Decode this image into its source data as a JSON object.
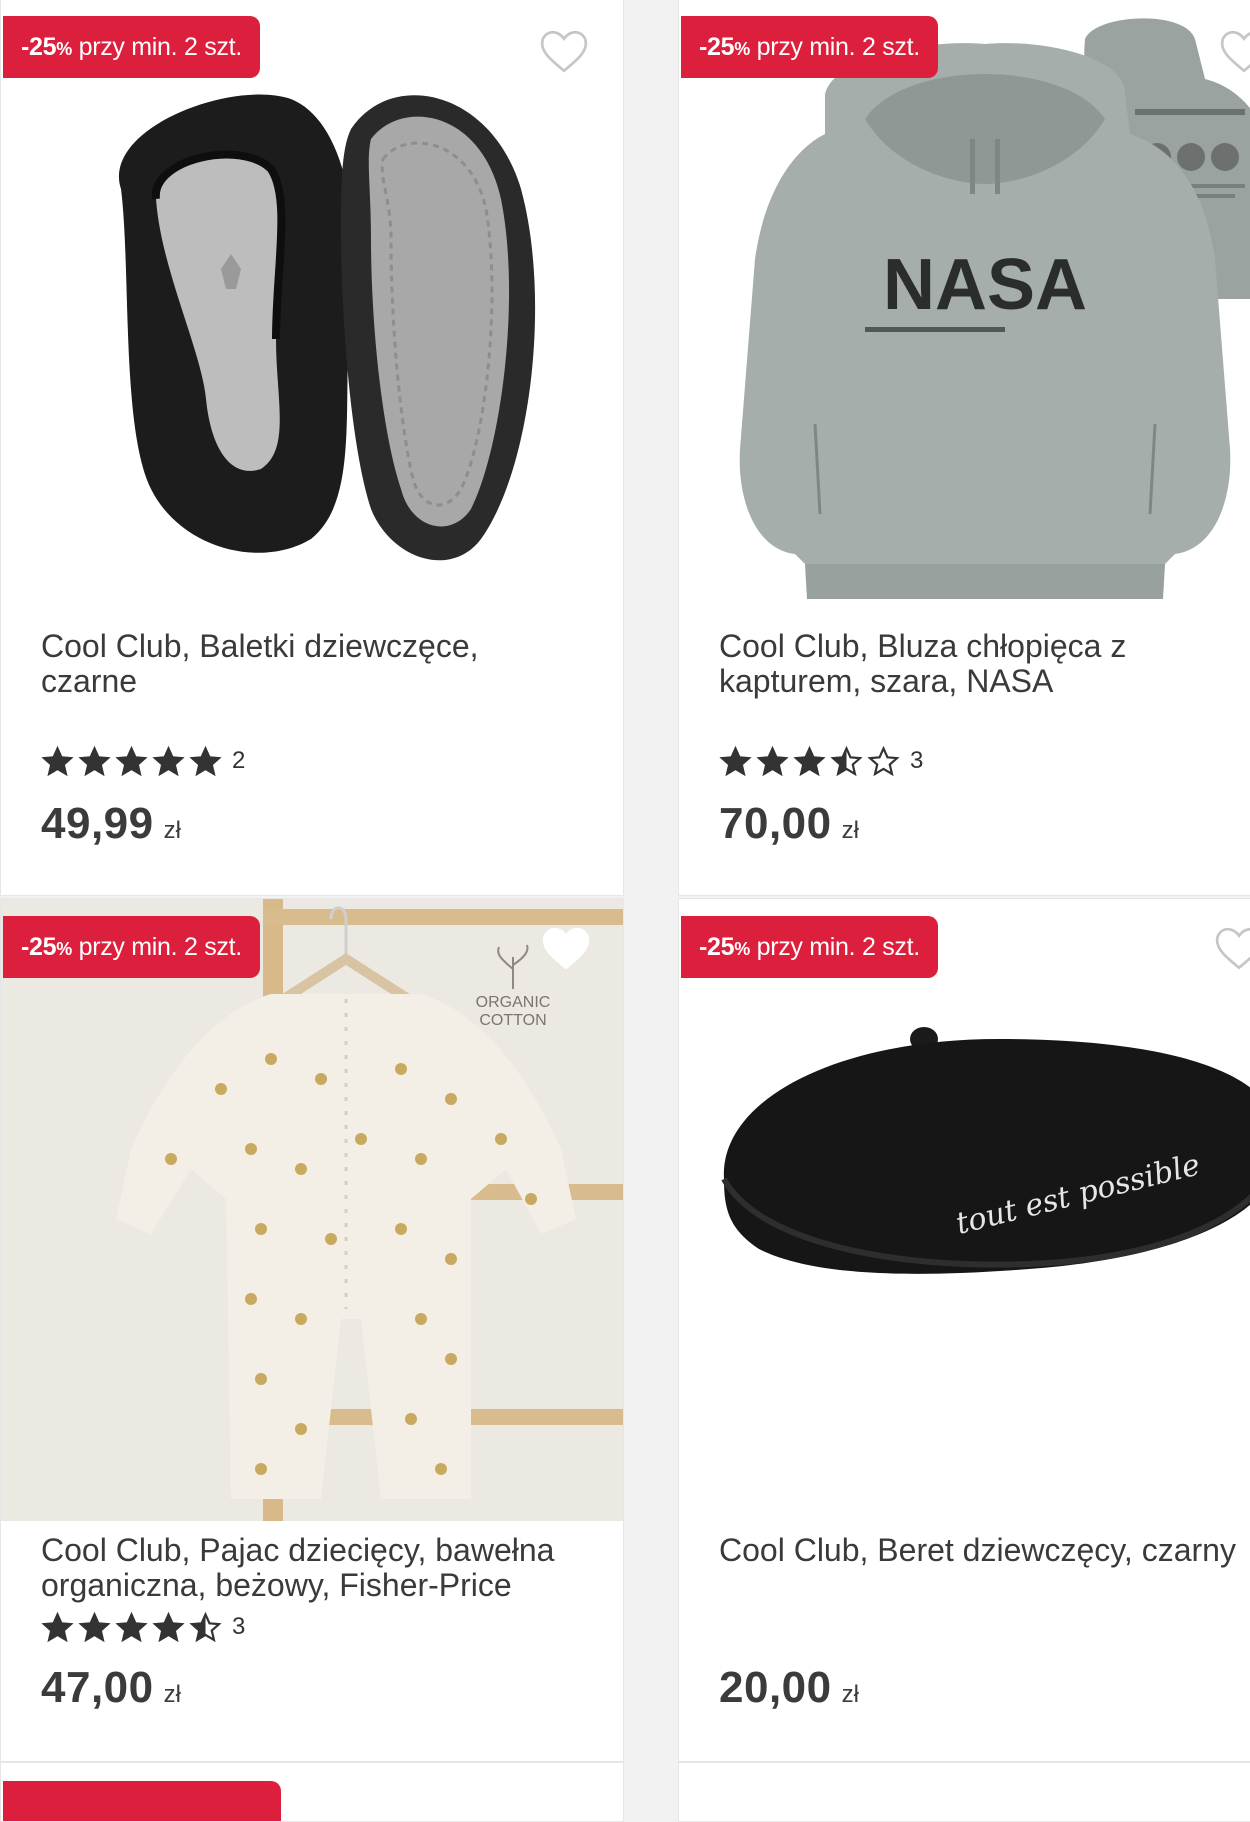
{
  "products": [
    {
      "badge": {
        "prefix": "-25",
        "pct": "%",
        "text": " przy min. 2 szt."
      },
      "title": "Cool Club, Baletki dziewczęce,\nczarne",
      "rating": 5,
      "rating_count": "2",
      "price": "49,99",
      "currency": "zł",
      "image_icon": "ballet-shoes-image"
    },
    {
      "badge": {
        "prefix": "-25",
        "pct": "%",
        "text": " przy min. 2 szt."
      },
      "title": "Cool Club, Bluza chłopięca z\nkapturem, szara, NASA",
      "rating": 3.5,
      "rating_count": "3",
      "price": "70,00",
      "currency": "zł",
      "image_icon": "hoodie-image",
      "print_text": "NASA"
    },
    {
      "badge": {
        "prefix": "-25",
        "pct": "%",
        "text": " przy min. 2 szt."
      },
      "title": "Cool Club, Pajac dziecięcy, bawełna\norganiczna, beżowy, Fisher-Price",
      "rating": 4.5,
      "rating_count": "3",
      "price": "47,00",
      "currency": "zł",
      "image_icon": "baby-romper-image",
      "tag_line1": "ORGANIC",
      "tag_line2": "COTTON"
    },
    {
      "badge": {
        "prefix": "-25",
        "pct": "%",
        "text": " przy min. 2 szt."
      },
      "title": "Cool Club, Beret dziewczęcy, czarny",
      "rating": null,
      "rating_count": "",
      "price": "20,00",
      "currency": "zł",
      "image_icon": "beret-image",
      "print_text": "tout est possible"
    }
  ],
  "colors": {
    "badge": "#dc1f3d",
    "star": "#333333",
    "text": "#3a3a3a"
  }
}
